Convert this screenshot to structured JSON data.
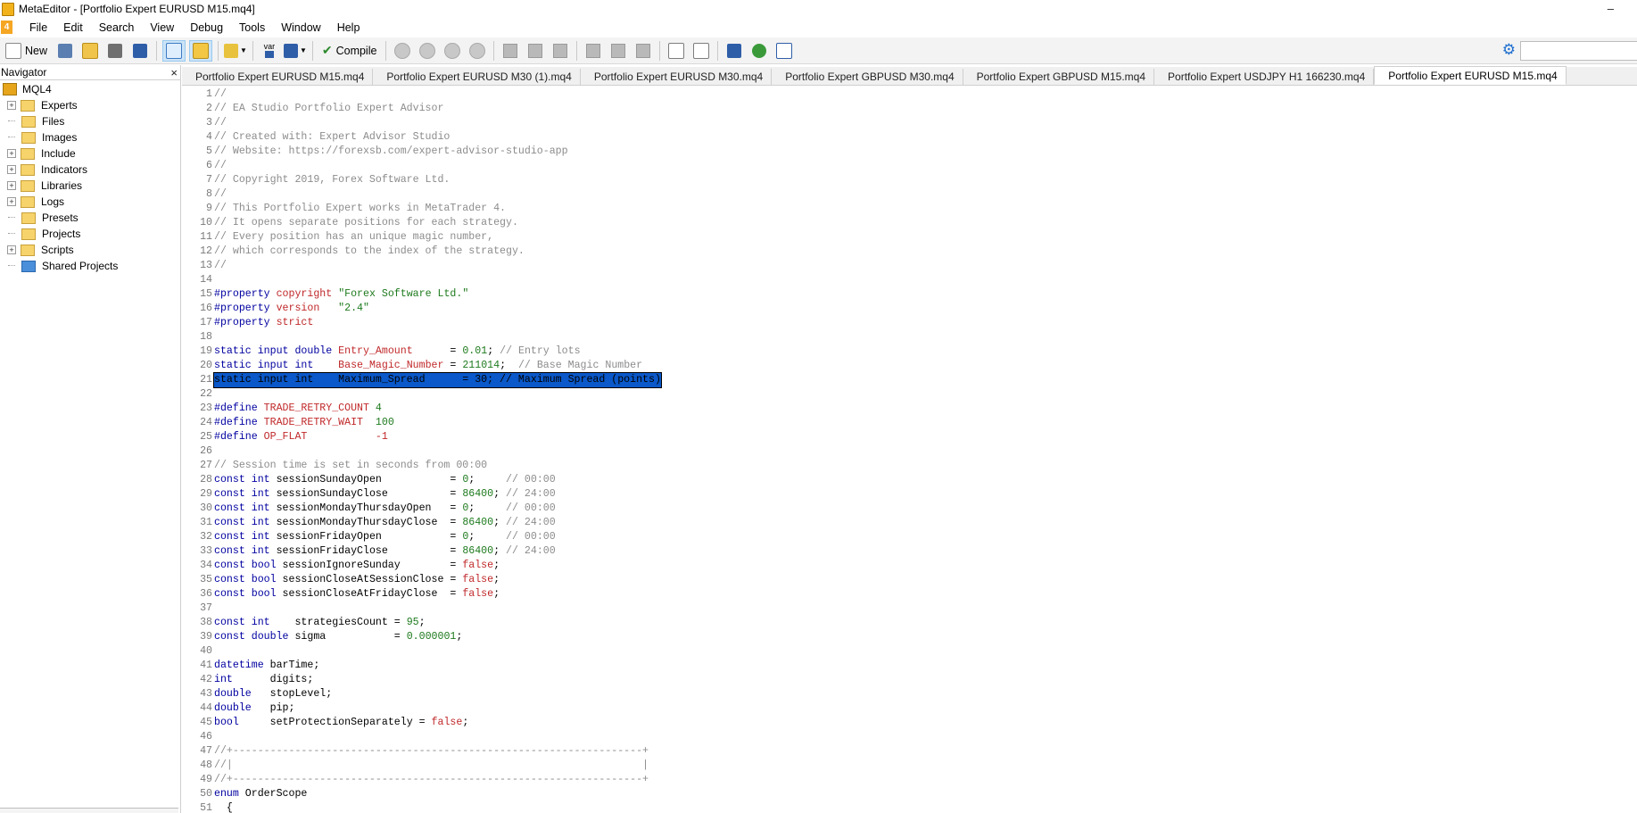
{
  "window": {
    "title": "MetaEditor - [Portfolio Expert EURUSD M15.mq4]",
    "minimize_glyph": "–"
  },
  "menu": {
    "logo_text": "4",
    "items": [
      "File",
      "Edit",
      "Search",
      "View",
      "Debug",
      "Tools",
      "Window",
      "Help"
    ]
  },
  "toolbar": {
    "new_label": "New",
    "compile_label": "Compile",
    "var_label": "var",
    "icons": [
      "new-icon",
      "new-from-template-icon",
      "open-icon",
      "save-icon",
      "save-all-icon",
      "navigator-toggle-icon",
      "toolbox-toggle-icon",
      "styler-icon",
      "insert-var-icon",
      "insert-function-icon",
      "compile-icon",
      "start-icon",
      "play-icon",
      "pause-icon",
      "stop-icon",
      "step-into-icon",
      "step-over-icon",
      "step-out-icon",
      "toggle-breakpoint-icon",
      "next-breakpoint-icon",
      "clear-breakpoints-icon",
      "copy-icon",
      "find-icon",
      "code-styler-icon",
      "check-icon",
      "chart-icon",
      "settings-gear-icon"
    ]
  },
  "navigator": {
    "title": "Navigator",
    "close_glyph": "×",
    "root": "MQL4",
    "items": [
      {
        "label": "Experts",
        "expandable": true,
        "color": "yellow"
      },
      {
        "label": "Files",
        "expandable": false,
        "color": "yellow"
      },
      {
        "label": "Images",
        "expandable": false,
        "color": "yellow"
      },
      {
        "label": "Include",
        "expandable": true,
        "color": "yellow"
      },
      {
        "label": "Indicators",
        "expandable": true,
        "color": "yellow"
      },
      {
        "label": "Libraries",
        "expandable": true,
        "color": "yellow"
      },
      {
        "label": "Logs",
        "expandable": true,
        "color": "yellow"
      },
      {
        "label": "Presets",
        "expandable": false,
        "color": "yellow"
      },
      {
        "label": "Projects",
        "expandable": false,
        "color": "yellow"
      },
      {
        "label": "Scripts",
        "expandable": true,
        "color": "yellow"
      },
      {
        "label": "Shared Projects",
        "expandable": false,
        "color": "blue"
      }
    ]
  },
  "tabs": [
    {
      "label": "Portfolio Expert EURUSD M15.mq4",
      "active": false
    },
    {
      "label": "Portfolio Expert EURUSD M30 (1).mq4",
      "active": false
    },
    {
      "label": "Portfolio Expert EURUSD M30.mq4",
      "active": false
    },
    {
      "label": "Portfolio Expert GBPUSD M30.mq4",
      "active": false
    },
    {
      "label": "Portfolio Expert GBPUSD M15.mq4",
      "active": false
    },
    {
      "label": "Portfolio Expert USDJPY H1 166230.mq4",
      "active": false
    },
    {
      "label": "Portfolio Expert EURUSD M15.mq4",
      "active": true
    }
  ],
  "colors": {
    "keyword": "#0000a0",
    "macro": "#c0282a",
    "string": "#1d7a1d",
    "comment": "#8c8c8c",
    "selection": "#0a58c9"
  },
  "code": {
    "selected_line": 21,
    "lines": [
      [
        [
          "c-com",
          "//"
        ]
      ],
      [
        [
          "c-com",
          "// EA Studio Portfolio Expert Advisor"
        ]
      ],
      [
        [
          "c-com",
          "//"
        ]
      ],
      [
        [
          "c-com",
          "// Created with: Expert Advisor Studio"
        ]
      ],
      [
        [
          "c-com",
          "// Website: https://forexsb.com/expert-advisor-studio-app"
        ]
      ],
      [
        [
          "c-com",
          "//"
        ]
      ],
      [
        [
          "c-com",
          "// Copyright 2019, Forex Software Ltd."
        ]
      ],
      [
        [
          "c-com",
          "//"
        ]
      ],
      [
        [
          "c-com",
          "// This Portfolio Expert works in MetaTrader 4."
        ]
      ],
      [
        [
          "c-com",
          "// It opens separate positions for each strategy."
        ]
      ],
      [
        [
          "c-com",
          "// Every position has an unique magic number,"
        ]
      ],
      [
        [
          "c-com",
          "// which corresponds to the index of the strategy."
        ]
      ],
      [
        [
          "c-com",
          "//"
        ]
      ],
      [],
      [
        [
          "c-kw",
          "#property"
        ],
        [
          "c-def",
          " "
        ],
        [
          "c-mac",
          "copyright"
        ],
        [
          "c-def",
          " "
        ],
        [
          "c-str",
          "\"Forex Software Ltd.\""
        ]
      ],
      [
        [
          "c-kw",
          "#property"
        ],
        [
          "c-def",
          " "
        ],
        [
          "c-mac",
          "version"
        ],
        [
          "c-def",
          "   "
        ],
        [
          "c-str",
          "\"2.4\""
        ]
      ],
      [
        [
          "c-kw",
          "#property"
        ],
        [
          "c-def",
          " "
        ],
        [
          "c-mac",
          "strict"
        ]
      ],
      [],
      [
        [
          "c-kw",
          "static input double"
        ],
        [
          "c-def",
          " "
        ],
        [
          "c-mac",
          "Entry_Amount"
        ],
        [
          "c-def",
          "      = "
        ],
        [
          "c-num",
          "0.01"
        ],
        [
          "c-def",
          "; "
        ],
        [
          "c-com",
          "// Entry lots"
        ]
      ],
      [
        [
          "c-kw",
          "static input int"
        ],
        [
          "c-def",
          "    "
        ],
        [
          "c-mac",
          "Base_Magic_Number"
        ],
        [
          "c-def",
          " = "
        ],
        [
          "c-num",
          "211014"
        ],
        [
          "c-def",
          ";  "
        ],
        [
          "c-com",
          "// Base Magic Number"
        ]
      ],
      [
        [
          "c-def",
          "static input int    Maximum_Spread      = 30; // Maximum Spread (points)"
        ]
      ],
      [],
      [
        [
          "c-kw",
          "#define"
        ],
        [
          "c-def",
          " "
        ],
        [
          "c-mac",
          "TRADE_RETRY_COUNT"
        ],
        [
          "c-def",
          " "
        ],
        [
          "c-num",
          "4"
        ]
      ],
      [
        [
          "c-kw",
          "#define"
        ],
        [
          "c-def",
          " "
        ],
        [
          "c-mac",
          "TRADE_RETRY_WAIT"
        ],
        [
          "c-def",
          "  "
        ],
        [
          "c-num",
          "100"
        ]
      ],
      [
        [
          "c-kw",
          "#define"
        ],
        [
          "c-def",
          " "
        ],
        [
          "c-mac",
          "OP_FLAT"
        ],
        [
          "c-def",
          "           "
        ],
        [
          "c-mac",
          "-1"
        ]
      ],
      [],
      [
        [
          "c-com",
          "// Session time is set in seconds from 00:00"
        ]
      ],
      [
        [
          "c-kw",
          "const int"
        ],
        [
          "c-def",
          " sessionSundayOpen           = "
        ],
        [
          "c-num",
          "0"
        ],
        [
          "c-def",
          ";     "
        ],
        [
          "c-com",
          "// 00:00"
        ]
      ],
      [
        [
          "c-kw",
          "const int"
        ],
        [
          "c-def",
          " sessionSundayClose          = "
        ],
        [
          "c-num",
          "86400"
        ],
        [
          "c-def",
          "; "
        ],
        [
          "c-com",
          "// 24:00"
        ]
      ],
      [
        [
          "c-kw",
          "const int"
        ],
        [
          "c-def",
          " sessionMondayThursdayOpen   = "
        ],
        [
          "c-num",
          "0"
        ],
        [
          "c-def",
          ";     "
        ],
        [
          "c-com",
          "// 00:00"
        ]
      ],
      [
        [
          "c-kw",
          "const int"
        ],
        [
          "c-def",
          " sessionMondayThursdayClose  = "
        ],
        [
          "c-num",
          "86400"
        ],
        [
          "c-def",
          "; "
        ],
        [
          "c-com",
          "// 24:00"
        ]
      ],
      [
        [
          "c-kw",
          "const int"
        ],
        [
          "c-def",
          " sessionFridayOpen           = "
        ],
        [
          "c-num",
          "0"
        ],
        [
          "c-def",
          ";     "
        ],
        [
          "c-com",
          "// 00:00"
        ]
      ],
      [
        [
          "c-kw",
          "const int"
        ],
        [
          "c-def",
          " sessionFridayClose          = "
        ],
        [
          "c-num",
          "86400"
        ],
        [
          "c-def",
          "; "
        ],
        [
          "c-com",
          "// 24:00"
        ]
      ],
      [
        [
          "c-kw",
          "const bool"
        ],
        [
          "c-def",
          " sessionIgnoreSunday        = "
        ],
        [
          "c-mac",
          "false"
        ],
        [
          "c-def",
          ";"
        ]
      ],
      [
        [
          "c-kw",
          "const bool"
        ],
        [
          "c-def",
          " sessionCloseAtSessionClose = "
        ],
        [
          "c-mac",
          "false"
        ],
        [
          "c-def",
          ";"
        ]
      ],
      [
        [
          "c-kw",
          "const bool"
        ],
        [
          "c-def",
          " sessionCloseAtFridayClose  = "
        ],
        [
          "c-mac",
          "false"
        ],
        [
          "c-def",
          ";"
        ]
      ],
      [],
      [
        [
          "c-kw",
          "const int"
        ],
        [
          "c-def",
          "    strategiesCount = "
        ],
        [
          "c-num",
          "95"
        ],
        [
          "c-def",
          ";"
        ]
      ],
      [
        [
          "c-kw",
          "const double"
        ],
        [
          "c-def",
          " sigma           = "
        ],
        [
          "c-num",
          "0.000001"
        ],
        [
          "c-def",
          ";"
        ]
      ],
      [],
      [
        [
          "c-kw",
          "datetime"
        ],
        [
          "c-def",
          " barTime;"
        ]
      ],
      [
        [
          "c-kw",
          "int"
        ],
        [
          "c-def",
          "      digits;"
        ]
      ],
      [
        [
          "c-kw",
          "double"
        ],
        [
          "c-def",
          "   stopLevel;"
        ]
      ],
      [
        [
          "c-kw",
          "double"
        ],
        [
          "c-def",
          "   pip;"
        ]
      ],
      [
        [
          "c-kw",
          "bool"
        ],
        [
          "c-def",
          "     setProtectionSeparately = "
        ],
        [
          "c-mac",
          "false"
        ],
        [
          "c-def",
          ";"
        ]
      ],
      [],
      [
        [
          "c-com",
          "//+------------------------------------------------------------------+"
        ]
      ],
      [
        [
          "c-com",
          "//|                                                                  |"
        ]
      ],
      [
        [
          "c-com",
          "//+------------------------------------------------------------------+"
        ]
      ],
      [
        [
          "c-kw",
          "enum"
        ],
        [
          "c-def",
          " OrderScope"
        ]
      ],
      [
        [
          "c-def",
          "  {"
        ]
      ]
    ]
  }
}
